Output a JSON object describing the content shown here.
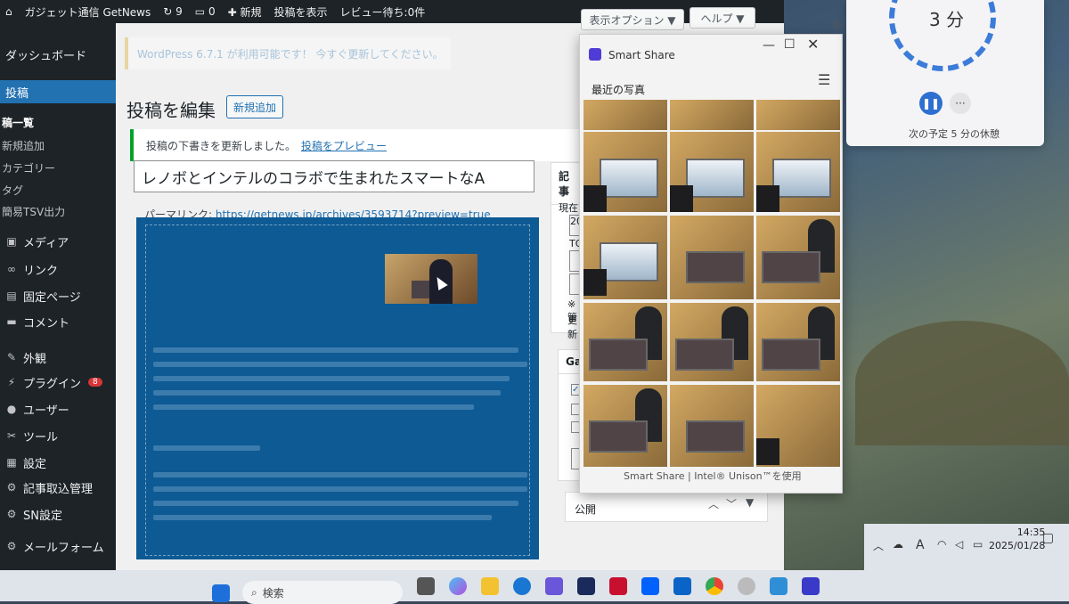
{
  "admin_bar": {
    "site_name": "ガジェット通信 GetNews",
    "updates_count": "9",
    "comments_count": "0",
    "new_label": "新規",
    "view_post": "投稿を表示",
    "review_pending": "レビュー待ち:0件"
  },
  "sidebar": {
    "items": [
      {
        "label": "ダッシュボード",
        "icon": "dashboard-icon"
      },
      {
        "label": "投稿",
        "icon": "pin-icon"
      },
      {
        "label": "稿一覧"
      },
      {
        "label": "新規追加"
      },
      {
        "label": "カテゴリー"
      },
      {
        "label": "タグ"
      },
      {
        "label": "簡易TSV出力"
      },
      {
        "label": "メディア",
        "icon": "media-icon"
      },
      {
        "label": "リンク",
        "icon": "link-icon"
      },
      {
        "label": "固定ページ",
        "icon": "page-icon"
      },
      {
        "label": "コメント",
        "icon": "comment-icon"
      },
      {
        "label": "外観",
        "icon": "brush-icon"
      },
      {
        "label": "プラグイン",
        "icon": "plugin-icon",
        "badge": "8"
      },
      {
        "label": "ユーザー",
        "icon": "user-icon"
      },
      {
        "label": "ツール",
        "icon": "wrench-icon"
      },
      {
        "label": "設定",
        "icon": "settings-icon"
      },
      {
        "label": "記事取込管理",
        "icon": "gear-icon"
      },
      {
        "label": "SN設定",
        "icon": "gear-icon"
      },
      {
        "label": "メールフォーム",
        "icon": "gear-icon"
      }
    ]
  },
  "screen_options": {
    "display_options": "表示オプション ▼",
    "help": "ヘルプ ▼"
  },
  "notices": {
    "update_nag": "WordPress 6.7.1 が利用可能です！ 今すぐ更新してください。",
    "updated_message": "投稿の下書きを更新しました。",
    "preview_link": "投稿をプレビュー"
  },
  "editor": {
    "page_title": "投稿を編集",
    "add_new": "新規追加",
    "post_title": "レノボとインテルのコラボで生まれたスマートなA",
    "permalink_label": "パーマリンク:",
    "permalink_url": "https://getnews.jp/archives/3593714?preview=true"
  },
  "right_sidebar": {
    "publish_box_title": "記事",
    "current_label": "現在",
    "year_prefix": "20",
    "top_label": "TOP",
    "note": "※管",
    "update_label": "更新",
    "gadget_box_title": "Gadg",
    "publish_title": "公開"
  },
  "smart_share": {
    "title": "Smart Share",
    "section": "最近の写真",
    "footer": "Smart Share | Intel® Unison™を使用",
    "photos": [
      {
        "scene": "hands"
      },
      {
        "scene": "hands"
      },
      {
        "scene": "hands"
      },
      {
        "scene": "laptop-open"
      },
      {
        "scene": "laptop-open"
      },
      {
        "scene": "laptop-open"
      },
      {
        "scene": "laptop-open"
      },
      {
        "scene": "laptop-closed"
      },
      {
        "scene": "person"
      },
      {
        "scene": "person"
      },
      {
        "scene": "person"
      },
      {
        "scene": "person"
      },
      {
        "scene": "person"
      },
      {
        "scene": "laptop-closed"
      },
      {
        "scene": "hands"
      }
    ]
  },
  "timer": {
    "value": "3 分",
    "next": "次の予定 5 分の休憩"
  },
  "taskbar": {
    "search_placeholder": "検索",
    "time": "14:35",
    "date": "2025/01/28",
    "ime": "A"
  }
}
